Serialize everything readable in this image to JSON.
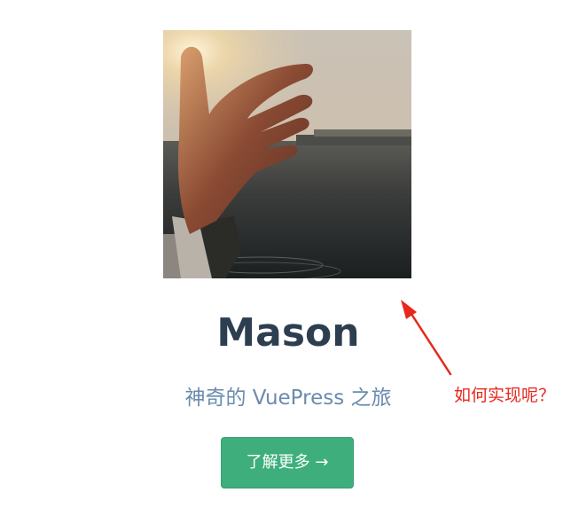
{
  "hero": {
    "image_alt": "hand against sunset over lake",
    "title": "Mason",
    "description": "神奇的 VuePress 之旅",
    "action_label": "了解更多 →"
  },
  "annotation": {
    "text": "如何实现呢？",
    "color": "#e8281d"
  },
  "colors": {
    "title": "#2c3e50",
    "description": "#6a8bad",
    "accent": "#3eaf7c"
  }
}
